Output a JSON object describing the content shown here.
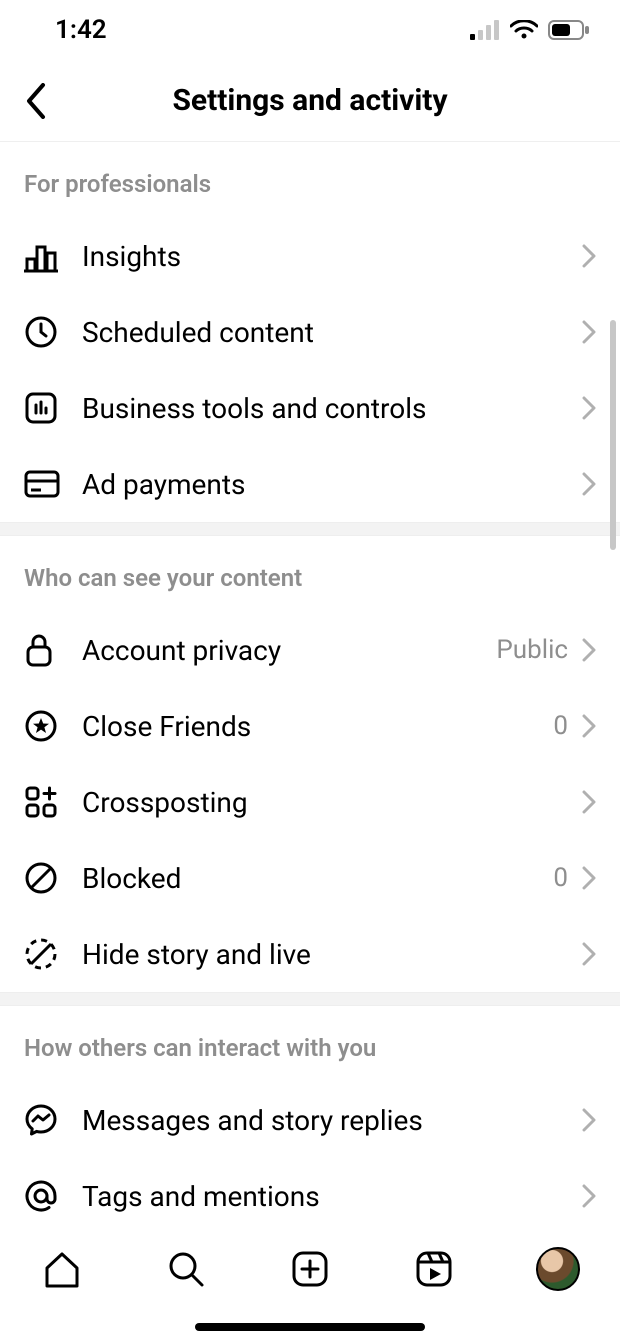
{
  "status": {
    "time": "1:42"
  },
  "header": {
    "title": "Settings and activity"
  },
  "sections": {
    "professionals": {
      "title": "For professionals",
      "items": {
        "insights": "Insights",
        "scheduled": "Scheduled content",
        "biztools": "Business tools and controls",
        "adpay": "Ad payments"
      }
    },
    "privacy": {
      "title": "Who can see your content",
      "items": {
        "account_privacy": {
          "label": "Account privacy",
          "value": "Public"
        },
        "close_friends": {
          "label": "Close Friends",
          "value": "0"
        },
        "crossposting": {
          "label": "Crossposting"
        },
        "blocked": {
          "label": "Blocked",
          "value": "0"
        },
        "hide_story": {
          "label": "Hide story and live"
        }
      }
    },
    "interact": {
      "title": "How others can interact with you",
      "items": {
        "messages": "Messages and story replies",
        "tags": "Tags and mentions"
      }
    }
  }
}
